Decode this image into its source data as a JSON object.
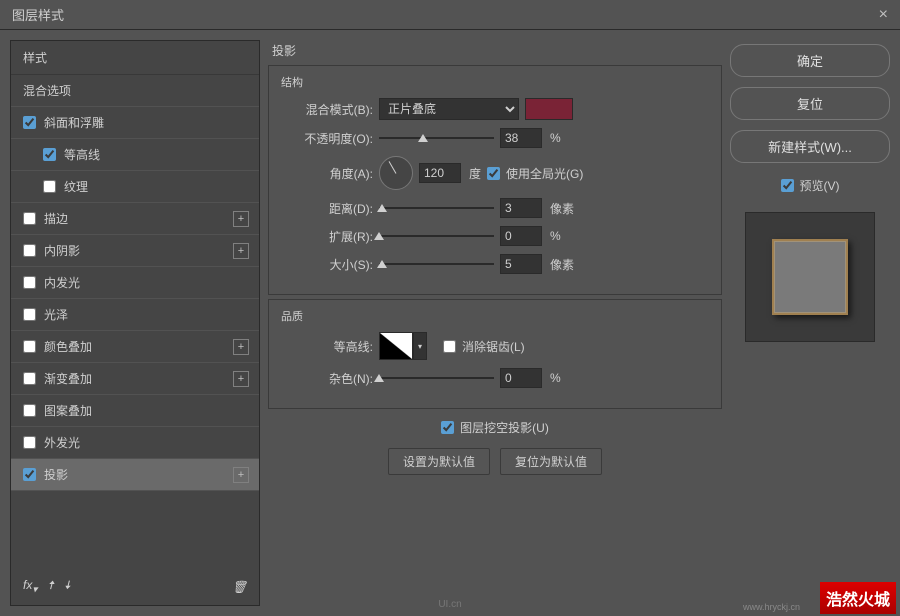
{
  "titlebar": {
    "title": "图层样式",
    "close": "×"
  },
  "left": {
    "header": "样式",
    "blend_options": "混合选项",
    "items": [
      {
        "label": "斜面和浮雕",
        "checked": true,
        "addable": false,
        "indent": false
      },
      {
        "label": "等高线",
        "checked": true,
        "addable": false,
        "indent": true
      },
      {
        "label": "纹理",
        "checked": false,
        "addable": false,
        "indent": true
      },
      {
        "label": "描边",
        "checked": false,
        "addable": true,
        "indent": false
      },
      {
        "label": "内阴影",
        "checked": false,
        "addable": true,
        "indent": false
      },
      {
        "label": "内发光",
        "checked": false,
        "addable": false,
        "indent": false
      },
      {
        "label": "光泽",
        "checked": false,
        "addable": false,
        "indent": false
      },
      {
        "label": "颜色叠加",
        "checked": false,
        "addable": true,
        "indent": false
      },
      {
        "label": "渐变叠加",
        "checked": false,
        "addable": true,
        "indent": false
      },
      {
        "label": "图案叠加",
        "checked": false,
        "addable": false,
        "indent": false
      },
      {
        "label": "外发光",
        "checked": false,
        "addable": false,
        "indent": false
      },
      {
        "label": "投影",
        "checked": true,
        "addable": true,
        "indent": false,
        "selected": true
      }
    ],
    "footer": {
      "fx": "fx",
      "trash": "🗑"
    }
  },
  "center": {
    "title": "投影",
    "structure": {
      "legend": "结构",
      "blend_mode_label": "混合模式(B):",
      "blend_mode_value": "正片叠底",
      "color": "#7a2336",
      "opacity_label": "不透明度(O):",
      "opacity_value": "38",
      "opacity_unit": "%",
      "angle_label": "角度(A):",
      "angle_value": "120",
      "angle_unit": "度",
      "global_light_label": "使用全局光(G)",
      "global_light_checked": true,
      "distance_label": "距离(D):",
      "distance_value": "3",
      "distance_unit": "像素",
      "spread_label": "扩展(R):",
      "spread_value": "0",
      "spread_unit": "%",
      "size_label": "大小(S):",
      "size_value": "5",
      "size_unit": "像素"
    },
    "quality": {
      "legend": "品质",
      "contour_label": "等高线:",
      "antialias_label": "消除锯齿(L)",
      "antialias_checked": false,
      "noise_label": "杂色(N):",
      "noise_value": "0",
      "noise_unit": "%"
    },
    "knockout_label": "图层挖空投影(U)",
    "knockout_checked": true,
    "btn_default": "设置为默认值",
    "btn_reset": "复位为默认值"
  },
  "right": {
    "ok": "确定",
    "reset": "复位",
    "new_style": "新建样式(W)...",
    "preview_label": "预览(V)",
    "preview_checked": true
  },
  "footer": {
    "watermark1": "UI.cn",
    "watermark2": "浩然火城",
    "watermark3": "www.hryckj.cn"
  }
}
